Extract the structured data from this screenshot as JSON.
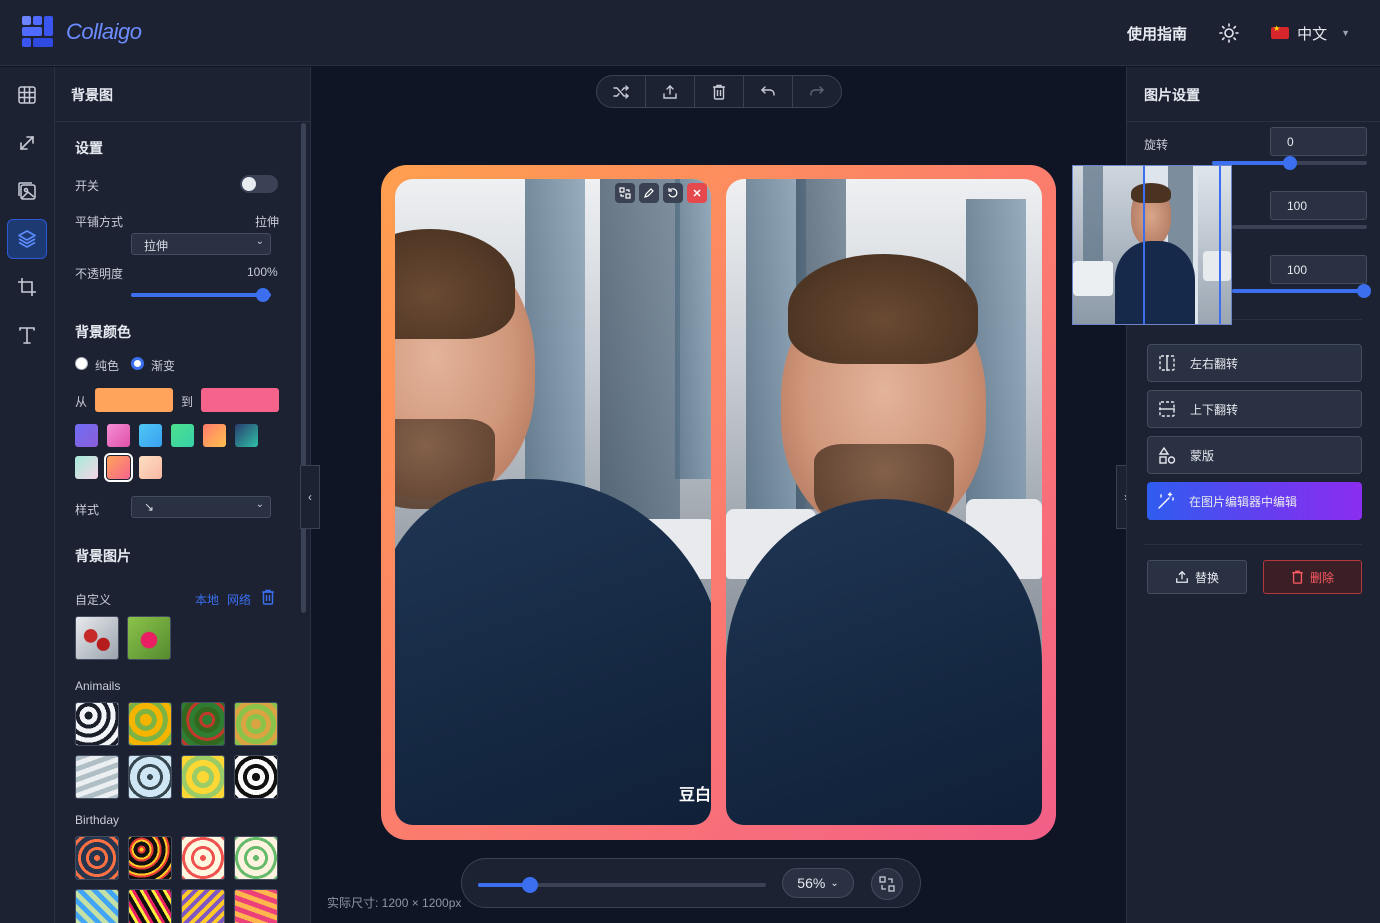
{
  "app": {
    "name": "Collaigo"
  },
  "header": {
    "guide_label": "使用指南",
    "language_label": "中文"
  },
  "left_panel": {
    "title": "背景图",
    "settings": {
      "heading": "设置",
      "switch_label": "开关",
      "tile_label": "平铺方式",
      "tile_value": "拉伸",
      "tile_select": "拉伸",
      "opacity_label": "不透明度",
      "opacity_value": "100%",
      "opacity_level": 1.0
    },
    "bg_color": {
      "heading": "背景颜色",
      "solid_label": "纯色",
      "gradient_label": "渐变",
      "from_label": "从",
      "to_label": "到",
      "from_color": "#ffa45a",
      "to_color": "#f6648c",
      "style_label": "样式",
      "style_value": "↘"
    },
    "bg_image": {
      "heading": "背景图片",
      "custom_label": "自定义",
      "local_link": "本地",
      "network_link": "网络",
      "animals_label": "Animails",
      "birthday_label": "Birthday"
    }
  },
  "canvas": {
    "watermark": "豆白",
    "zoom_value": "56%",
    "zoom_level": 0.18,
    "actual_size": "实际尺寸: 1200 × 1200px"
  },
  "right_panel": {
    "title": "图片设置",
    "rotate_label": "旋转",
    "rotate_value": "0",
    "value2": "100",
    "value3": "100",
    "flip_h_label": "左右翻转",
    "flip_v_label": "上下翻转",
    "mask_label": "蒙版",
    "edit_label": "在图片编辑器中编辑",
    "replace_label": "替换",
    "delete_label": "删除"
  },
  "colors": {
    "accent": "#3b6ff0",
    "danger": "#e5484d",
    "frame_from": "#ff9f4e",
    "frame_to": "#f25f88"
  }
}
